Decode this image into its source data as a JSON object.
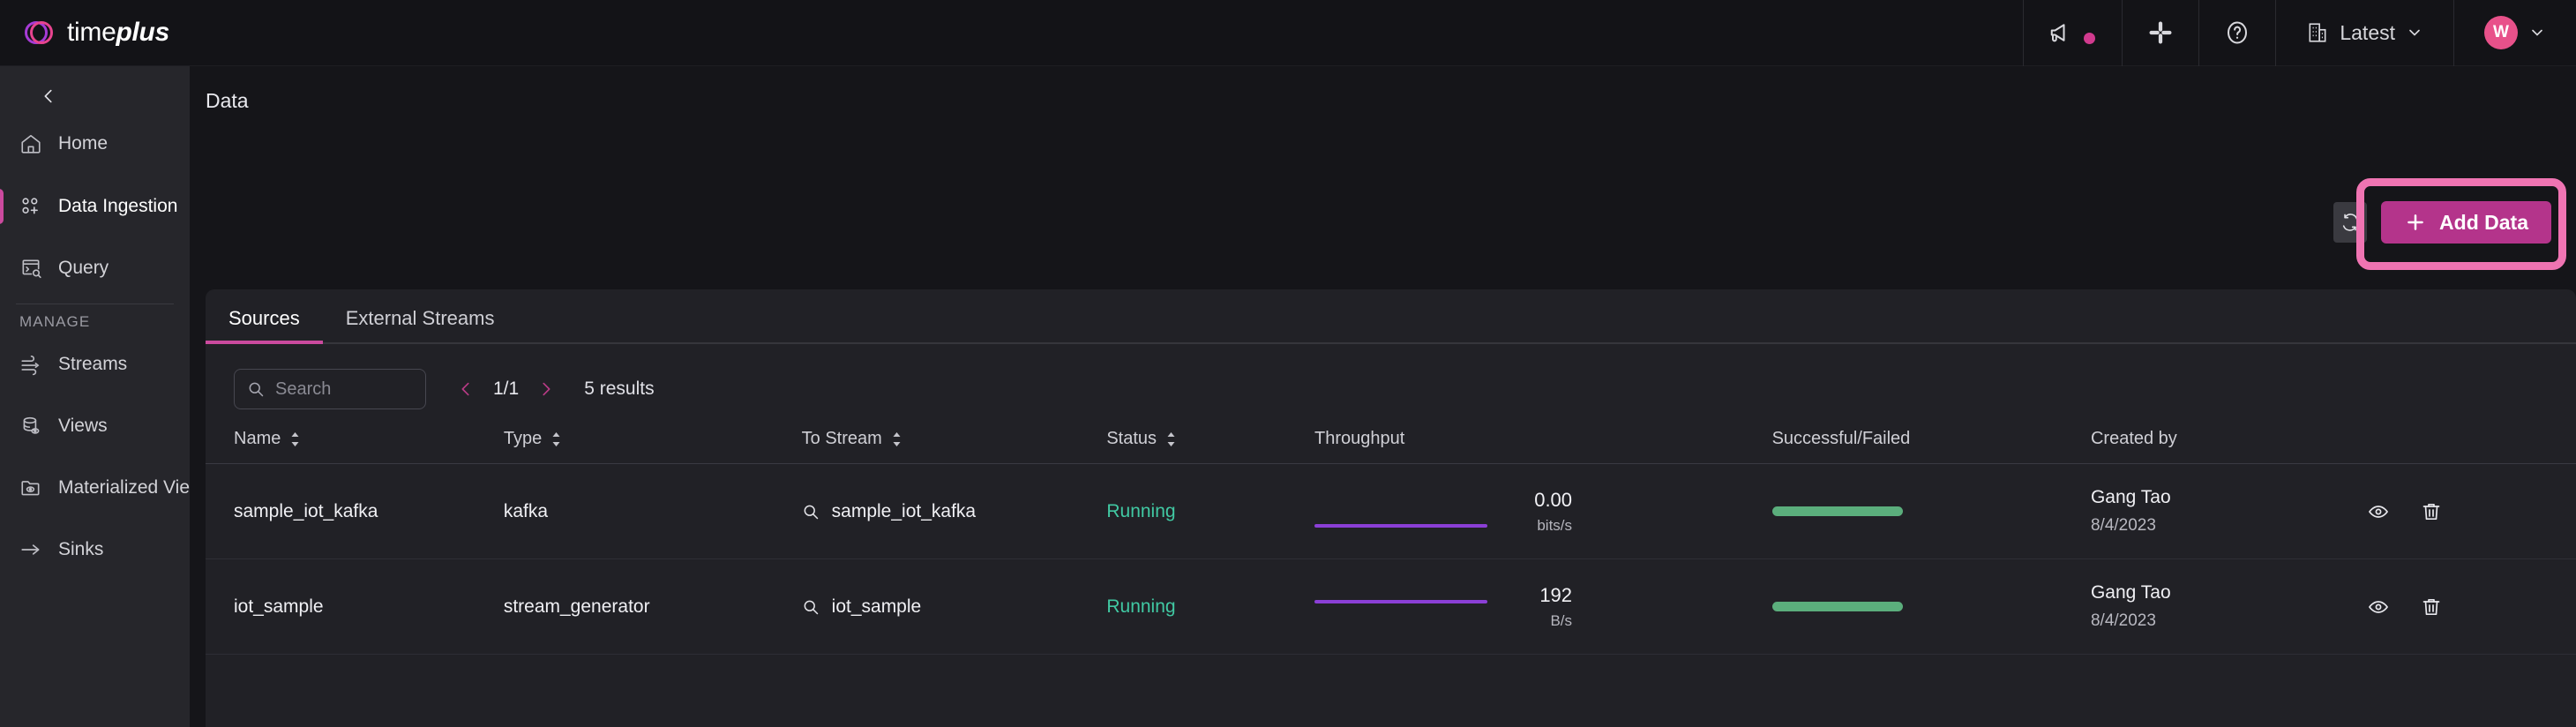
{
  "brand": {
    "name_light": "time",
    "name_bold": "plus",
    "logo_icon": "timeplus-logo-icon"
  },
  "topbar": {
    "announcement_icon": "megaphone-icon",
    "slack_icon": "slack-icon",
    "help_icon": "help-circle-icon",
    "workspace_icon": "building-icon",
    "workspace_label": "Latest",
    "workspace_chevron": "chevron-down-icon",
    "avatar_initial": "W",
    "avatar_chevron": "chevron-down-icon",
    "accent_pink": "#d13a8e"
  },
  "sidebar": {
    "collapse_icon": "chevron-left-icon",
    "items": [
      {
        "label": "Home",
        "icon": "home-icon",
        "active": false
      },
      {
        "label": "Data Ingestion",
        "icon": "data-ingestion-icon",
        "active": true
      },
      {
        "label": "Query",
        "icon": "query-icon",
        "active": false
      }
    ],
    "section_label": "MANAGE",
    "manage_items": [
      {
        "label": "Streams",
        "icon": "streams-icon"
      },
      {
        "label": "Views",
        "icon": "views-icon"
      },
      {
        "label": "Materialized Views",
        "icon": "materialized-views-icon"
      },
      {
        "label": "Sinks",
        "icon": "sinks-icon"
      }
    ],
    "active_indicator_color": "#cb4a9e"
  },
  "main": {
    "page_title": "Data",
    "refresh_icon": "refresh-icon",
    "add_button": {
      "label": "Add Data",
      "icon": "plus-icon",
      "color": "#b4348b",
      "highlight_color": "#ef74b2"
    },
    "tabs": [
      {
        "label": "Sources",
        "active": true
      },
      {
        "label": "External Streams",
        "active": false
      }
    ],
    "search": {
      "placeholder": "Search",
      "value": "",
      "icon": "search-icon"
    },
    "pagination": {
      "prev_icon": "chevron-left-icon",
      "page": "1/1",
      "next_icon": "chevron-right-icon",
      "results": "5 results"
    },
    "table": {
      "columns": [
        {
          "label": "Name",
          "sortable": true
        },
        {
          "label": "Type",
          "sortable": true
        },
        {
          "label": "To Stream",
          "sortable": true
        },
        {
          "label": "Status",
          "sortable": true
        },
        {
          "label": "Throughput",
          "sortable": false
        },
        {
          "label": "Successful/Failed",
          "sortable": false
        },
        {
          "label": "Created by",
          "sortable": false
        }
      ],
      "rows": [
        {
          "name": "sample_iot_kafka",
          "type": "kafka",
          "to_stream": "sample_iot_kafka",
          "status": "Running",
          "throughput_value": "0.00",
          "throughput_unit": "bits/s",
          "created_by": "Gang Tao",
          "created_date": "8/4/2023",
          "view_icon": "eye-icon",
          "delete_icon": "trash-icon"
        },
        {
          "name": "iot_sample",
          "type": "stream_generator",
          "to_stream": "iot_sample",
          "status": "Running",
          "throughput_value": "192",
          "throughput_unit": "B/s",
          "created_by": "Gang Tao",
          "created_date": "8/4/2023",
          "view_icon": "eye-icon",
          "delete_icon": "trash-icon"
        }
      ]
    }
  }
}
